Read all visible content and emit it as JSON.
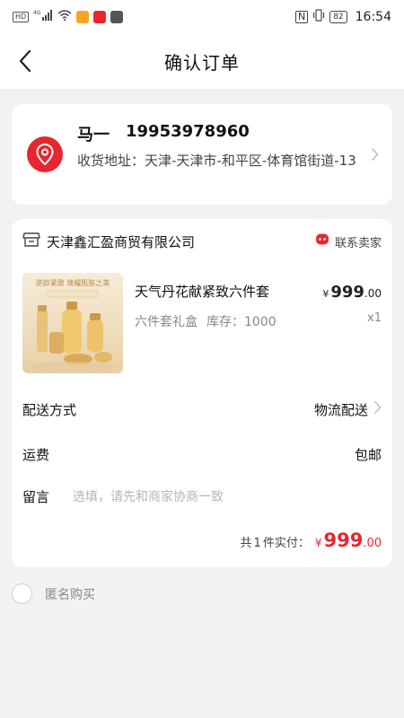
{
  "status_bar": {
    "left_badges": [
      "HD",
      "4G"
    ],
    "battery": "82",
    "time": "16:54",
    "nfc_label": "N"
  },
  "nav": {
    "title": "确认订单"
  },
  "address": {
    "name": "马一",
    "phone": "19953978960",
    "text": "收货地址：天津-天津市-和平区-体育馆街道-13"
  },
  "shop": {
    "name": "天津鑫汇盈商贸有限公司",
    "contact_label": "联系卖家"
  },
  "product": {
    "name": "天气丹花献紧致六件套",
    "spec": "六件套礼盒",
    "stock": "库存：1000",
    "price_symbol": "¥",
    "price_int": "999",
    "price_dec": ".00",
    "qty": "x1",
    "image_caption": "逆龄紧致 焕耀肌肤之美"
  },
  "delivery": {
    "label": "配送方式",
    "value": "物流配送"
  },
  "shipping": {
    "label": "运费",
    "value": "包邮"
  },
  "note": {
    "label": "留言",
    "placeholder": "选填，请先和商家协商一致"
  },
  "total": {
    "count_prefix": "共",
    "count": "1",
    "count_suffix": "件实付：",
    "symbol": "¥",
    "int": "999",
    "dec": ".00"
  },
  "anonymous": {
    "label": "匿名购买",
    "checked": false
  },
  "colors": {
    "accent": "#e8262f",
    "background": "#f2f2f2"
  }
}
